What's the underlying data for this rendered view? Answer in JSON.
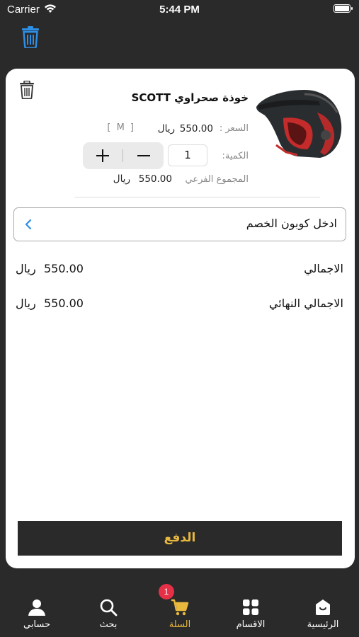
{
  "status_bar": {
    "carrier": "Carrier",
    "time": "5:44 PM"
  },
  "cart_item": {
    "title": "خوذة صحراوي SCOTT",
    "price_label": "السعر :",
    "price_value": "550.00",
    "currency": "ريال",
    "size": "[ M ]",
    "quantity_label": "الكمية:",
    "quantity_value": "1",
    "subtotal_label": "المجموع الفرعي",
    "subtotal_value": "550.00"
  },
  "coupon": {
    "placeholder": "ادخل كوبون الخصم"
  },
  "totals": {
    "total_label": "الاجمالي",
    "total_value": "550.00",
    "final_label": "الاجمالي النهائي",
    "final_value": "550.00",
    "currency": "ريال"
  },
  "pay_button": {
    "label": "الدفع"
  },
  "tabbar": {
    "items": [
      {
        "label": "الرئيسية",
        "icon": "home-icon"
      },
      {
        "label": "الاقسام",
        "icon": "grid-icon"
      },
      {
        "label": "السلة",
        "icon": "cart-icon",
        "active": true
      },
      {
        "label": "بحث",
        "icon": "search-icon"
      },
      {
        "label": "حسابي",
        "icon": "profile-icon"
      }
    ],
    "cart_badge": "1"
  },
  "colors": {
    "accent": "#e9b93e",
    "dark": "#2a2a2a",
    "badge": "#e53047",
    "trash_blue": "#2d8fe6"
  }
}
